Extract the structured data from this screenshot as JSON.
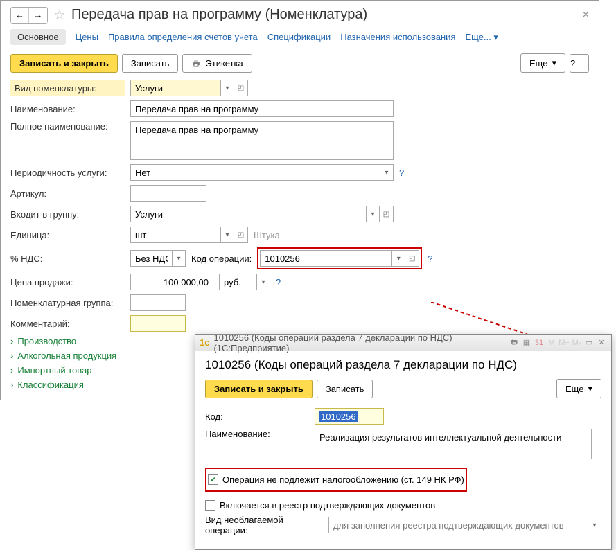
{
  "title": "Передача прав на программу (Номенклатура)",
  "tabs": {
    "main": "Основное",
    "prices": "Цены",
    "rules": "Правила определения счетов учета",
    "specs": "Спецификации",
    "assign": "Назначения использования",
    "more": "Еще..."
  },
  "toolbar": {
    "save_close": "Записать и закрыть",
    "save": "Записать",
    "label": "Этикетка",
    "more": "Еще",
    "help": "?"
  },
  "form": {
    "type_label": "Вид номенклатуры:",
    "type_value": "Услуги",
    "name_label": "Наименование:",
    "name_value": "Передача прав на программу",
    "fullname_label": "Полное наименование:",
    "fullname_value": "Передача прав на программу",
    "period_label": "Периодичность услуги:",
    "period_value": "Нет",
    "article_label": "Артикул:",
    "article_value": "",
    "group_label": "Входит в группу:",
    "group_value": "Услуги",
    "unit_label": "Единица:",
    "unit_value": "шт",
    "unit_hint": "Штука",
    "vat_label": "% НДС:",
    "vat_value": "Без НДС",
    "opcode_label": "Код операции:",
    "opcode_value": "1010256",
    "price_label": "Цена продажи:",
    "price_value": "100 000,00",
    "currency": "руб.",
    "nomgroup_label": "Номенклатурная группа:",
    "comment_label": "Комментарий:"
  },
  "sidelinks": [
    "Производство",
    "Алкогольная продукция",
    "Импортный товар",
    "Классификация"
  ],
  "popup": {
    "tb_title": "1010256 (Коды операций раздела 7 декларации по НДС)",
    "tb_app": "(1С:Предприятие)",
    "heading": "1010256 (Коды операций раздела 7 декларации по НДС)",
    "save_close": "Записать и закрыть",
    "save": "Записать",
    "more": "Еще",
    "code_label": "Код:",
    "code_value": "1010256",
    "name_label": "Наименование:",
    "name_value": "Реализация результатов интеллектуальной деятельности",
    "cb1": "Операция не подлежит налогообложению (ст. 149 НК РФ)",
    "cb2": "Включается в реестр подтверждающих документов",
    "optype_label": "Вид необлагаемой операции:",
    "optype_placeholder": "для заполнения реестра подтверждающих документов"
  },
  "tb_letters": [
    "M",
    "M+",
    "M-"
  ]
}
